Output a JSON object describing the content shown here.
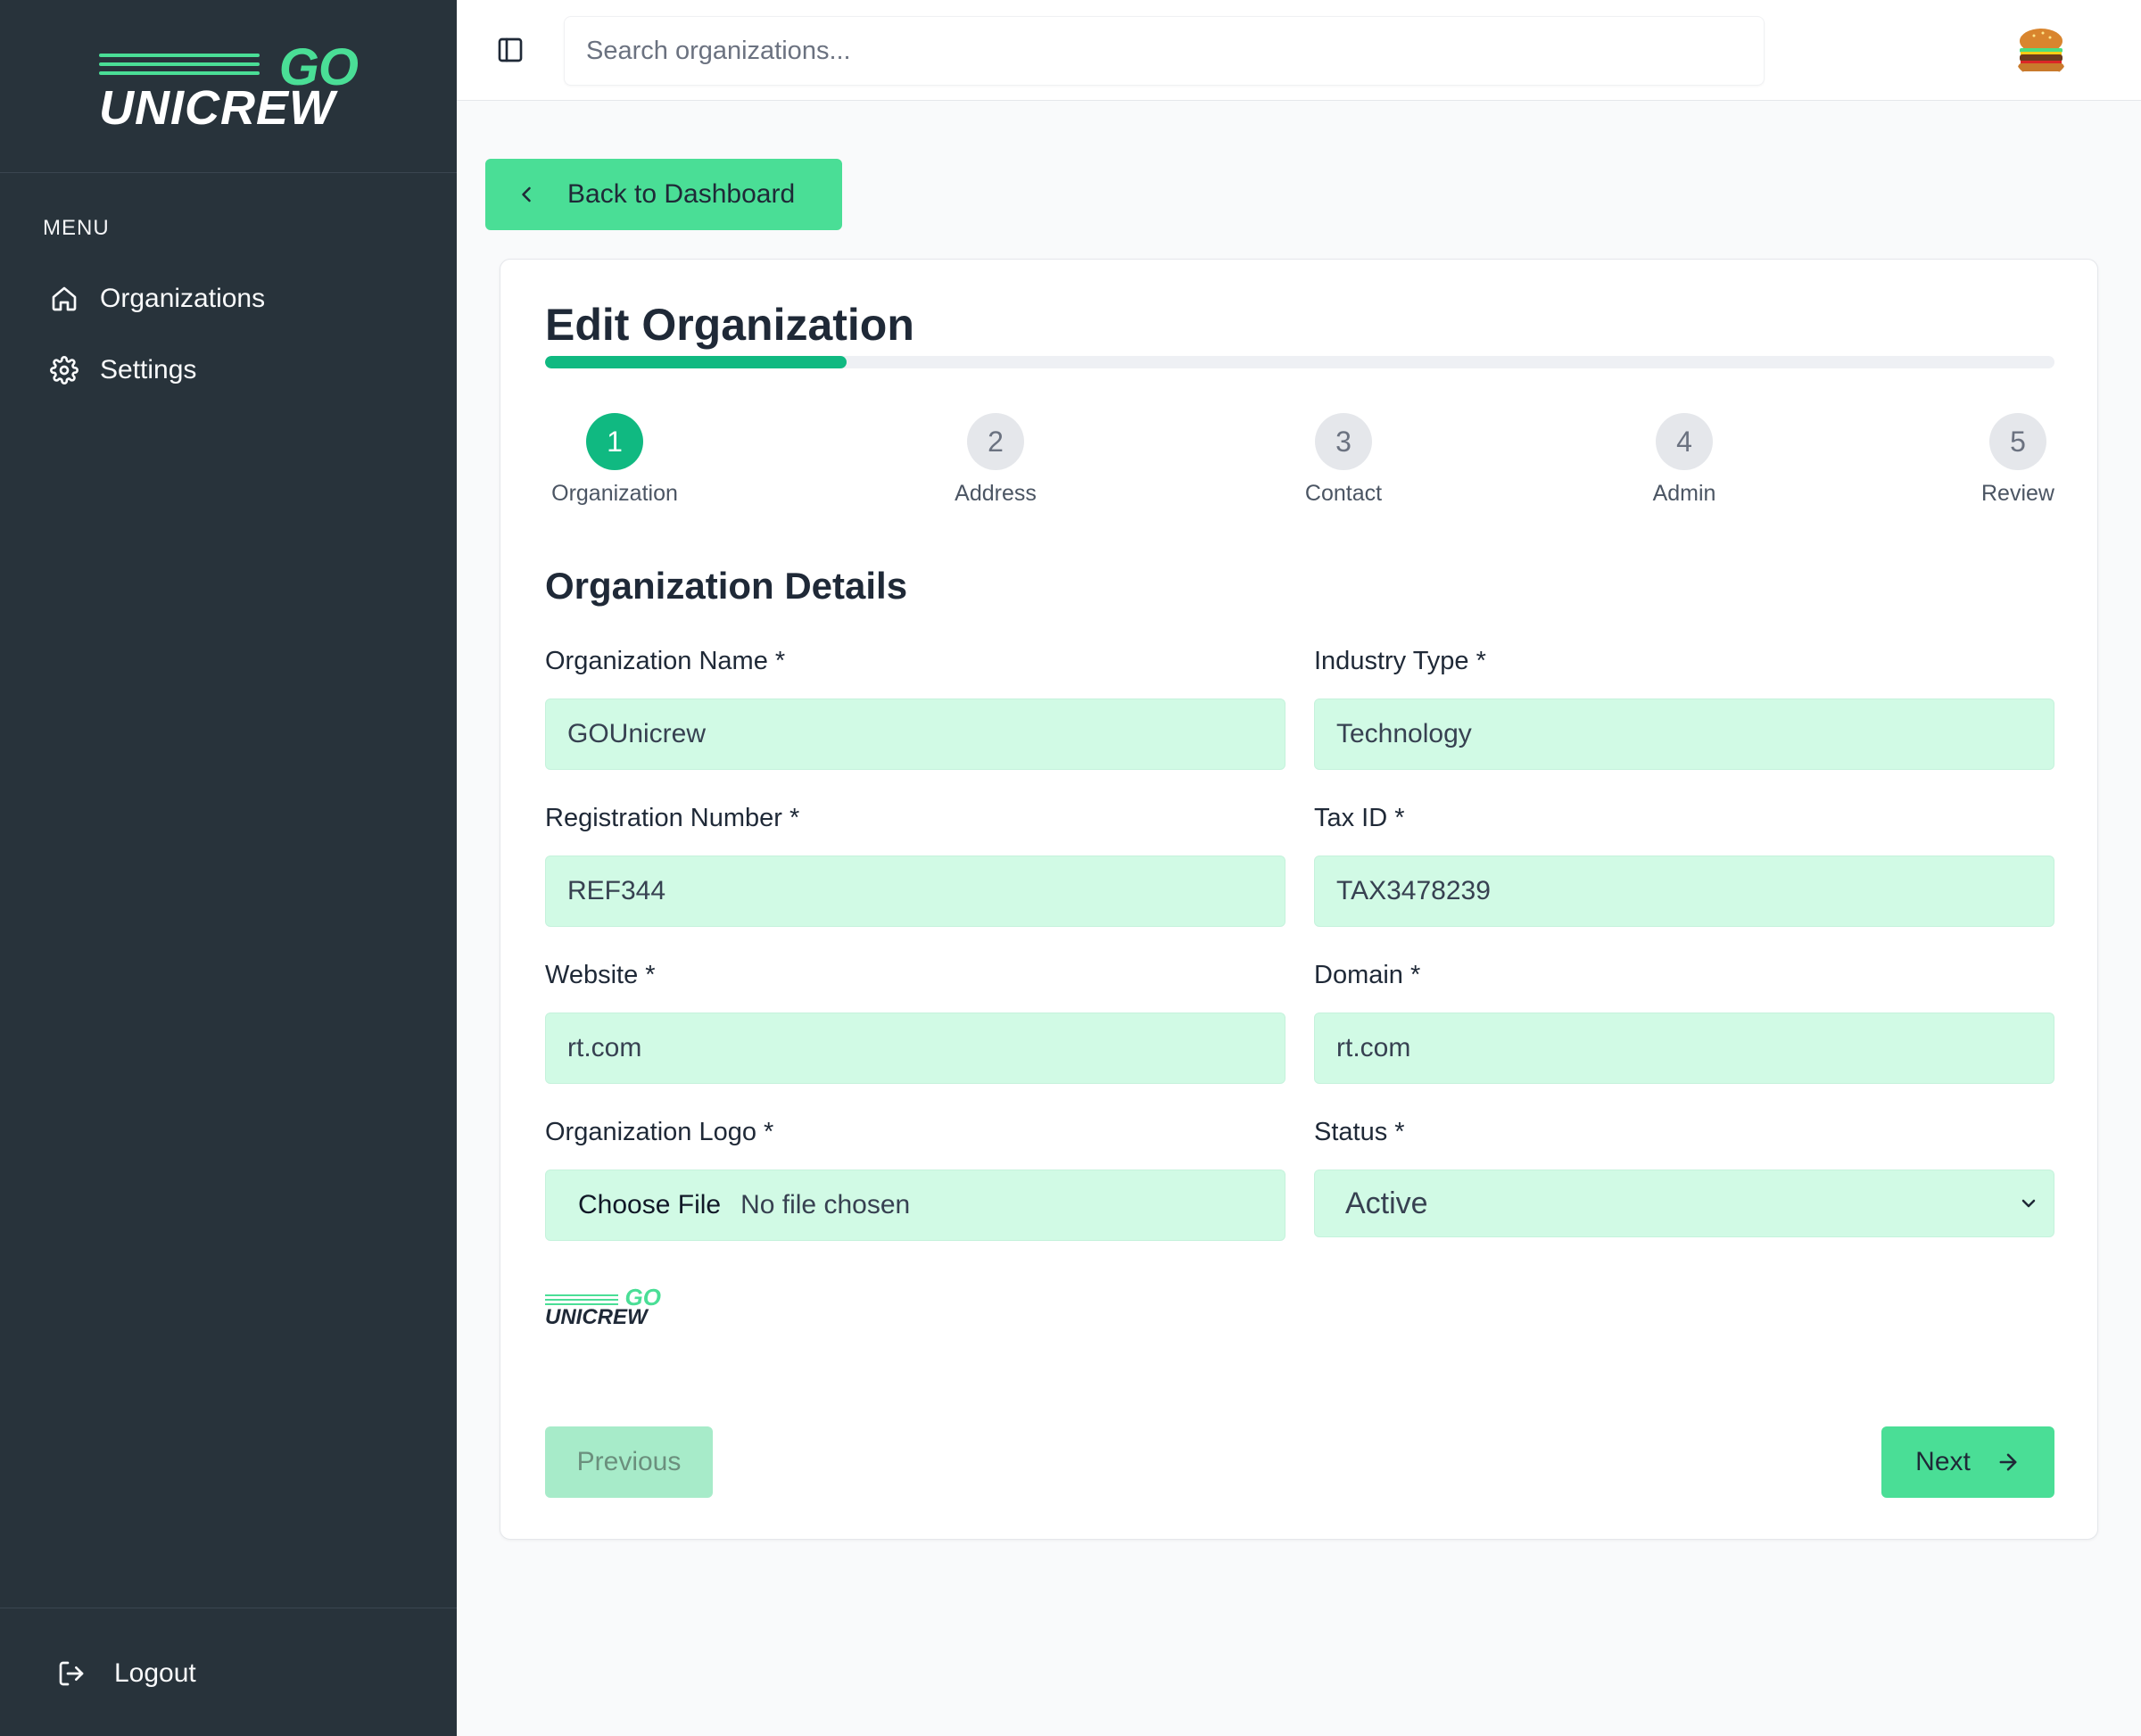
{
  "brand": {
    "go": "GO",
    "name": "UNICREW"
  },
  "sidebar": {
    "menu_label": "MENU",
    "items": [
      {
        "label": "Organizations",
        "icon": "home-icon"
      },
      {
        "label": "Settings",
        "icon": "gear-icon"
      }
    ],
    "logout_label": "Logout"
  },
  "topbar": {
    "search_placeholder": "Search organizations..."
  },
  "back_button_label": "Back to Dashboard",
  "form": {
    "title": "Edit Organization",
    "progress_fraction": 0.2,
    "steps": [
      {
        "number": "1",
        "label": "Organization",
        "active": true
      },
      {
        "number": "2",
        "label": "Address",
        "active": false
      },
      {
        "number": "3",
        "label": "Contact",
        "active": false
      },
      {
        "number": "4",
        "label": "Admin",
        "active": false
      },
      {
        "number": "5",
        "label": "Review",
        "active": false
      }
    ],
    "section_title": "Organization Details",
    "fields": {
      "org_name": {
        "label": "Organization Name *",
        "value": "GOUnicrew"
      },
      "industry": {
        "label": "Industry Type *",
        "value": "Technology"
      },
      "reg_number": {
        "label": "Registration Number *",
        "value": "REF344"
      },
      "tax_id": {
        "label": "Tax ID *",
        "value": "TAX3478239"
      },
      "website": {
        "label": "Website *",
        "value": "rt.com"
      },
      "domain": {
        "label": "Domain *",
        "value": "rt.com"
      },
      "logo": {
        "label": "Organization Logo *",
        "button": "Choose File",
        "status": "No file chosen"
      },
      "status": {
        "label": "Status *",
        "value": "Active"
      }
    },
    "previous_label": "Previous",
    "next_label": "Next"
  },
  "colors": {
    "sidebar_bg": "#28333b",
    "accent": "#4ade96",
    "accent_dark": "#10b981",
    "input_bg": "#d1fae5"
  }
}
